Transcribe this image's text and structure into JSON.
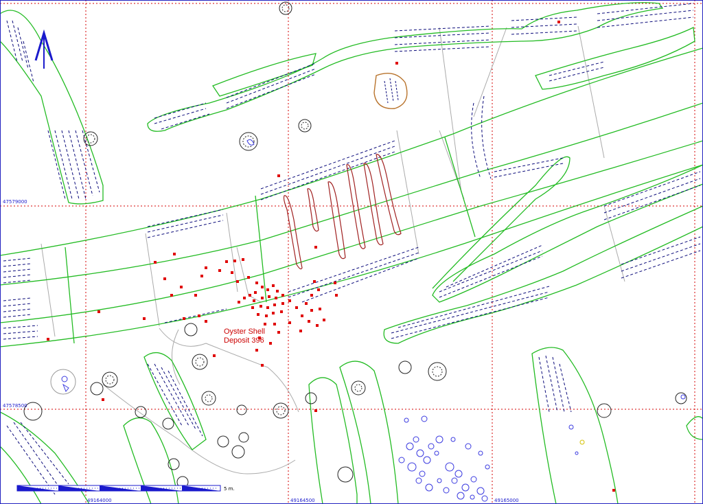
{
  "map": {
    "colors": {
      "background": "#ffffff",
      "grid": "#d40000",
      "feature_outline": "#22bb22",
      "hachure": "#0a0a7a",
      "artifact": "#e00000",
      "furrow": "#a02020",
      "pit": "#b8732c",
      "stone": "#3a3ae0",
      "frame": "#2020c0"
    },
    "grid_labels": {
      "northing_upper": "47579000",
      "northing_lower": "47578500",
      "easting_left": "49164000",
      "easting_mid": "49164500",
      "easting_right": "49165000"
    },
    "annotation": {
      "line1": "Oyster Shell",
      "line2": "Deposit 396"
    },
    "north_arrow": {
      "icon": "north-arrow-icon"
    },
    "scale_bar": {
      "label": "5 m."
    }
  }
}
